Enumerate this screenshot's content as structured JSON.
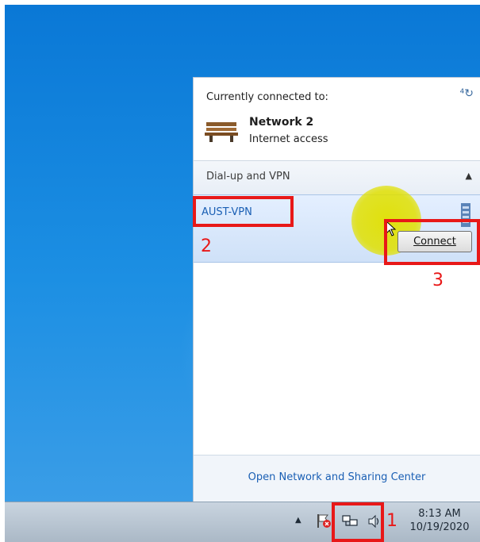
{
  "flyout": {
    "current_label": "Currently connected to:",
    "network_name": "Network 2",
    "network_status": "Internet access",
    "section_label": "Dial-up and VPN",
    "vpn_name": "AUST-VPN",
    "connect_label": "Connect",
    "footer_link": "Open Network and Sharing Center"
  },
  "taskbar": {
    "time": "8:13 AM",
    "date": "10/19/2020"
  },
  "annotations": {
    "step1": "1",
    "step2": "2",
    "step3": "3"
  },
  "colors": {
    "annotation": "#e81818",
    "link": "#1a5fb4",
    "highlight": "#e0e000"
  }
}
